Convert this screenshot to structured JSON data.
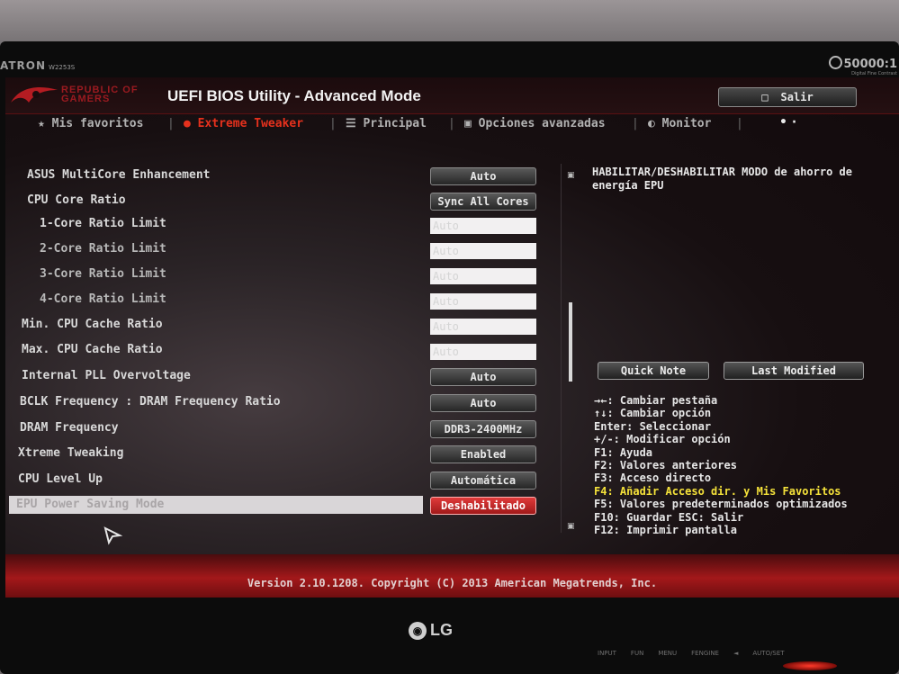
{
  "monitor": {
    "brand_label": "ATRON",
    "model_label": "W2253S",
    "contrast_label": "50000:1",
    "contrast_sub": "Digital Fine Contrast",
    "maker_logo": "LG",
    "buttons": [
      "INPUT",
      "FUN",
      "MENU",
      "FENGINE",
      "◄",
      "AUTO/SET"
    ]
  },
  "header": {
    "rog_text": "REPUBLIC OF GAMERS",
    "title": "UEFI BIOS Utility - Advanced Mode",
    "exit_label": "Salir",
    "exit_icon": "exit-door-icon"
  },
  "tabs": [
    {
      "label": "Mis favoritos",
      "icon": "star-icon",
      "active": false
    },
    {
      "label": "Extreme Tweaker",
      "icon": "tweaker-icon",
      "active": true
    },
    {
      "label": "Principal",
      "icon": "list-icon",
      "active": false
    },
    {
      "label": "Opciones avanzadas",
      "icon": "advanced-icon",
      "active": false
    },
    {
      "label": "Monitor",
      "icon": "monitor-icon",
      "active": false
    }
  ],
  "settings": [
    {
      "label": "ASUS MultiCore Enhancement",
      "value": "Auto",
      "kind": "button"
    },
    {
      "label": "CPU Core Ratio",
      "value": "Sync All Cores",
      "kind": "button"
    },
    {
      "label": "1-Core Ratio Limit",
      "value": "Auto",
      "kind": "field"
    },
    {
      "label": "2-Core Ratio Limit",
      "value": "Auto",
      "kind": "field"
    },
    {
      "label": "3-Core Ratio Limit",
      "value": "Auto",
      "kind": "field"
    },
    {
      "label": "4-Core Ratio Limit",
      "value": "Auto",
      "kind": "field"
    },
    {
      "label": "Min. CPU Cache Ratio",
      "value": "Auto",
      "kind": "field"
    },
    {
      "label": "Max. CPU Cache Ratio",
      "value": "Auto",
      "kind": "field"
    },
    {
      "label": "Internal PLL Overvoltage",
      "value": "Auto",
      "kind": "button"
    },
    {
      "label": "BCLK Frequency : DRAM Frequency Ratio",
      "value": "Auto",
      "kind": "button"
    },
    {
      "label": "DRAM Frequency",
      "value": "DDR3-2400MHz",
      "kind": "button"
    },
    {
      "label": "Xtreme Tweaking",
      "value": "Enabled",
      "kind": "button"
    },
    {
      "label": "CPU Level Up",
      "value": "Automática",
      "kind": "button"
    },
    {
      "label": "EPU Power Saving Mode",
      "value": "Deshabilitado",
      "kind": "button",
      "selected": true
    }
  ],
  "help": {
    "description": "HABILITAR/DESHABILITAR MODO de ahorro de energía EPU",
    "quick_note": "Quick Note",
    "last_modified": "Last Modified"
  },
  "keys": [
    {
      "text": "→←: Cambiar pestaña",
      "highlight": false
    },
    {
      "text": "↑↓: Cambiar opción",
      "highlight": false
    },
    {
      "text": "Enter: Seleccionar",
      "highlight": false
    },
    {
      "text": "+/-: Modificar opción",
      "highlight": false
    },
    {
      "text": "F1: Ayuda",
      "highlight": false
    },
    {
      "text": "F2: Valores anteriores",
      "highlight": false
    },
    {
      "text": "F3: Acceso directo",
      "highlight": false
    },
    {
      "text": "F4: Añadir Acceso dir. y Mis Favoritos",
      "highlight": true
    },
    {
      "text": "F5: Valores predeterminados optimizados",
      "highlight": false
    },
    {
      "text": "F10: Guardar  ESC: Salir",
      "highlight": false
    },
    {
      "text": "F12: Imprimir pantalla",
      "highlight": false
    }
  ],
  "footer": {
    "version": "Version 2.10.1208. Copyright (C) 2013 American Megatrends, Inc."
  },
  "colors": {
    "accent_red": "#e5311d",
    "highlight_yellow": "#f5e23a",
    "selected_button": "#d42a2a"
  }
}
